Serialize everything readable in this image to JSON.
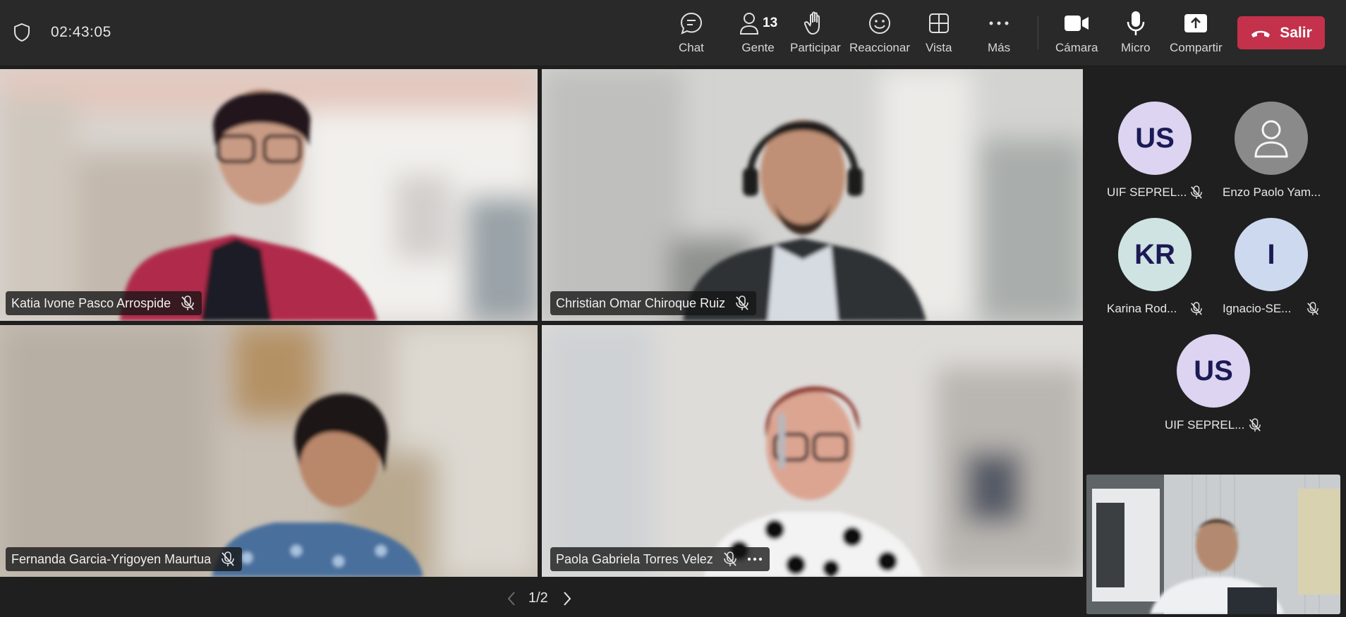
{
  "header": {
    "timer": "02:43:05",
    "tools": {
      "chat": "Chat",
      "people": "Gente",
      "people_count": "13",
      "raise": "Participar",
      "react": "Reaccionar",
      "view": "Vista",
      "more": "Más",
      "camera": "Cámara",
      "mic": "Micro",
      "share": "Compartir"
    },
    "leave_label": "Salir"
  },
  "tiles": [
    {
      "name": "Katia Ivone Pasco Arrospide"
    },
    {
      "name": "Christian Omar Chiroque Ruiz"
    },
    {
      "name": "Fernanda Garcia-Yrigoyen Maurtua"
    },
    {
      "name": "Paola Gabriela Torres Velez"
    }
  ],
  "participants": [
    {
      "initials": "US",
      "name": "UIF SEPREL..."
    },
    {
      "initials": "",
      "name": "Enzo Paolo Yam..."
    },
    {
      "initials": "KR",
      "name": "Karina Rod..."
    },
    {
      "initials": "I",
      "name": "Ignacio-SE..."
    },
    {
      "initials": "US",
      "name": "UIF SEPREL..."
    }
  ],
  "pager": {
    "label": "1/2"
  },
  "colors": {
    "leave": "#c4314b",
    "avatar_us": "#dcd4f0",
    "avatar_kr": "#cfe3e2",
    "avatar_i": "#cdd9ef",
    "avatar_generic": "#8a8a8a"
  }
}
